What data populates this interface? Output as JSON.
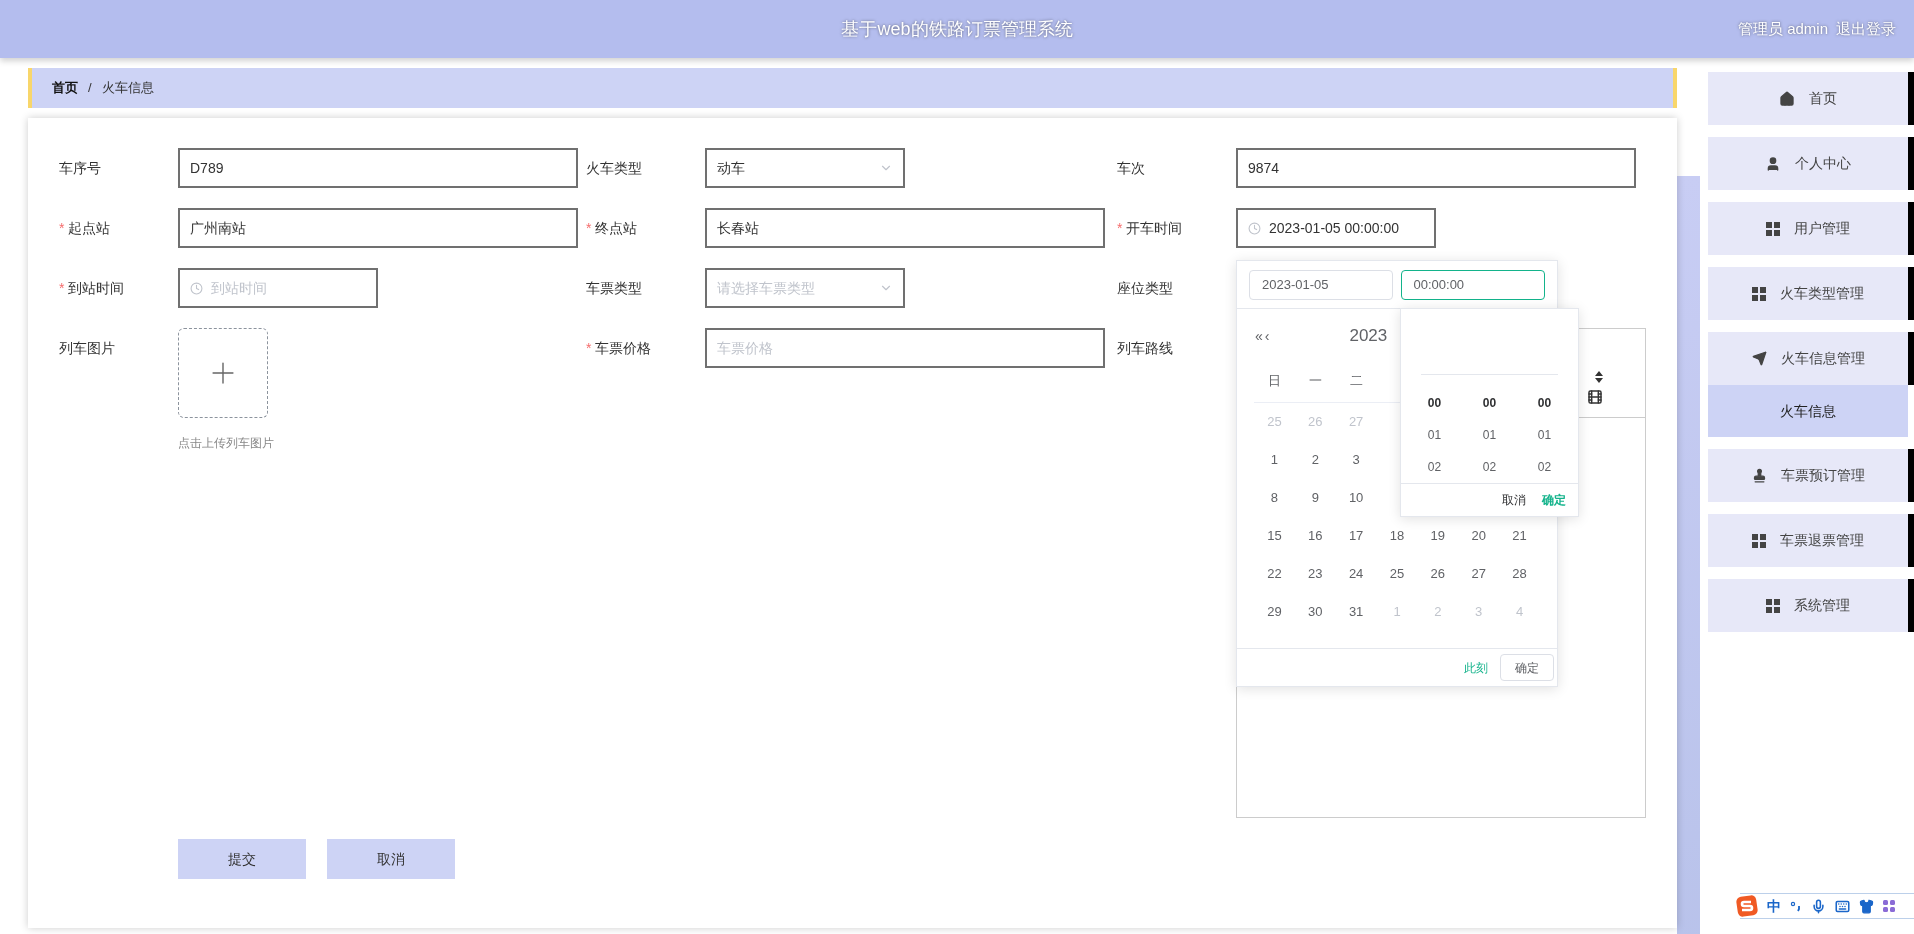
{
  "header": {
    "title": "基于web的铁路订票管理系统",
    "user": "管理员 admin",
    "logout": "退出登录"
  },
  "breadcrumb": {
    "separator": "/",
    "items": [
      {
        "label": "首页",
        "current": false
      },
      {
        "label": "火车信息",
        "current": true
      }
    ]
  },
  "form": {
    "required_mark": "*",
    "fields": [
      {
        "kind": "text",
        "label": "车序号",
        "required": false,
        "value": "D789"
      },
      {
        "kind": "select",
        "label": "火车类型",
        "required": false,
        "value": "动车"
      },
      {
        "kind": "text",
        "label": "车次",
        "required": false,
        "value": "9874"
      },
      {
        "kind": "text",
        "label": "起点站",
        "required": true,
        "value": "广州南站"
      },
      {
        "kind": "text",
        "label": "终点站",
        "required": true,
        "value": "长春站"
      },
      {
        "kind": "datetime",
        "label": "开车时间",
        "required": true,
        "value": "2023-01-05 00:00:00",
        "open": true
      },
      {
        "kind": "datetime",
        "label": "到站时间",
        "required": true,
        "placeholder": "到站时间",
        "open": false
      },
      {
        "kind": "select",
        "label": "车票类型",
        "required": false,
        "placeholder": "请选择车票类型"
      },
      {
        "kind": "covered",
        "label": "座位类型",
        "required": false
      },
      {
        "kind": "upload",
        "label": "列车图片",
        "required": false,
        "hint": "点击上传列车图片"
      },
      {
        "kind": "text",
        "label": "车票价格",
        "required": true,
        "placeholder": "车票价格"
      },
      {
        "kind": "editor",
        "label": "列车路线",
        "required": false
      }
    ],
    "buttons": [
      {
        "label": "提交"
      },
      {
        "label": "取消"
      }
    ]
  },
  "date_picker": {
    "date_value": "2023-01-05",
    "time_value": "00:00:00",
    "nav": "«‹",
    "year": "2023",
    "weekdays": [
      "日",
      "一",
      "二"
    ],
    "weeks": [
      {
        "days": [
          {
            "label": "25",
            "other_month": true
          },
          {
            "label": "26",
            "other_month": true
          },
          {
            "label": "27",
            "other_month": true
          }
        ]
      },
      {
        "days": [
          {
            "label": "1",
            "other_month": false
          },
          {
            "label": "2",
            "other_month": false
          },
          {
            "label": "3",
            "other_month": false
          }
        ]
      },
      {
        "days": [
          {
            "label": "8",
            "other_month": false
          },
          {
            "label": "9",
            "other_month": false
          },
          {
            "label": "10",
            "other_month": false
          }
        ]
      },
      {
        "days": [
          {
            "label": "15",
            "other_month": false
          },
          {
            "label": "16",
            "other_month": false
          },
          {
            "label": "17",
            "other_month": false
          },
          {
            "label": "18",
            "other_month": false
          },
          {
            "label": "19",
            "other_month": false
          },
          {
            "label": "20",
            "other_month": false
          },
          {
            "label": "21",
            "other_month": false
          }
        ]
      },
      {
        "days": [
          {
            "label": "22",
            "other_month": false
          },
          {
            "label": "23",
            "other_month": false
          },
          {
            "label": "24",
            "other_month": false
          },
          {
            "label": "25",
            "other_month": false
          },
          {
            "label": "26",
            "other_month": false
          },
          {
            "label": "27",
            "other_month": false
          },
          {
            "label": "28",
            "other_month": false
          }
        ]
      },
      {
        "days": [
          {
            "label": "29",
            "other_month": false
          },
          {
            "label": "30",
            "other_month": false
          },
          {
            "label": "31",
            "other_month": false
          },
          {
            "label": "1",
            "other_month": true
          },
          {
            "label": "2",
            "other_month": true
          },
          {
            "label": "3",
            "other_month": true
          },
          {
            "label": "4",
            "other_month": true
          }
        ]
      }
    ],
    "now": "此刻",
    "confirm": "确定",
    "time_panel": {
      "columns": [
        {
          "items": [
            {
              "label": "00",
              "selected": true
            },
            {
              "label": "01",
              "selected": false
            },
            {
              "label": "02",
              "selected": false
            }
          ]
        },
        {
          "items": [
            {
              "label": "00",
              "selected": true
            },
            {
              "label": "01",
              "selected": false
            },
            {
              "label": "02",
              "selected": false
            }
          ]
        },
        {
          "items": [
            {
              "label": "00",
              "selected": true
            },
            {
              "label": "01",
              "selected": false
            },
            {
              "label": "02",
              "selected": false
            }
          ]
        }
      ],
      "cancel": "取消",
      "confirm": "确定"
    }
  },
  "sidebar": {
    "items": [
      {
        "label": "首页",
        "selected": false
      },
      {
        "label": "个人中心",
        "selected": false
      },
      {
        "label": "用户管理",
        "selected": false
      },
      {
        "label": "火车类型管理",
        "selected": false
      },
      {
        "label": "火车信息管理",
        "selected": false,
        "children": [
          {
            "label": "火车信息",
            "selected": true
          }
        ]
      },
      {
        "label": "车票预订管理",
        "selected": false
      },
      {
        "label": "车票退票管理",
        "selected": false
      },
      {
        "label": "系统管理",
        "selected": false
      }
    ]
  },
  "ime_toolbar": {
    "mode": "中"
  }
}
